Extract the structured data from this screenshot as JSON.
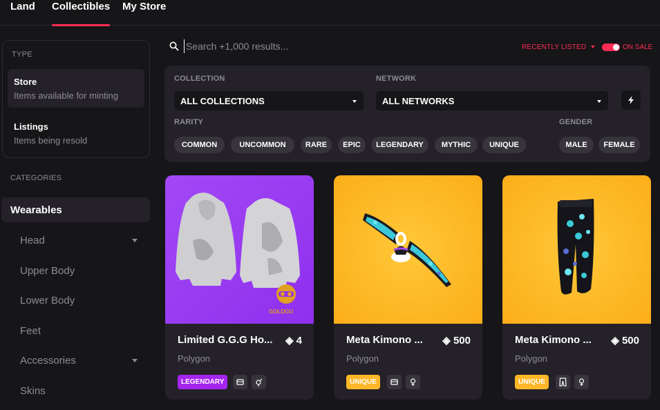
{
  "nav": {
    "tabs": [
      "Land",
      "Collectibles",
      "My Store"
    ]
  },
  "type_filter": {
    "title": "TYPE",
    "items": [
      {
        "name": "Store",
        "desc": "Items available for minting"
      },
      {
        "name": "Listings",
        "desc": "Items being resold"
      }
    ]
  },
  "categories": {
    "title": "CATEGORIES",
    "active": "Wearables",
    "items": [
      "Head",
      "Upper Body",
      "Lower Body",
      "Feet",
      "Accessories",
      "Skins"
    ]
  },
  "search": {
    "placeholder": "Search +1,000 results..."
  },
  "sort": {
    "label": "RECENTLY LISTED"
  },
  "on_sale": {
    "label": "ON SALE",
    "enabled": true
  },
  "filters": {
    "collection_label": "COLLECTION",
    "collection_value": "ALL COLLECTIONS",
    "network_label": "NETWORK",
    "network_value": "ALL NETWORKS",
    "rarity_label": "RARITY",
    "rarities": [
      "COMMON",
      "UNCOMMON",
      "RARE",
      "EPIC",
      "LEGENDARY",
      "MYTHIC",
      "UNIQUE"
    ],
    "gender_label": "GENDER",
    "genders": [
      "MALE",
      "FEMALE"
    ]
  },
  "cards": [
    {
      "title": "Limited G.G.G Ho...",
      "price": "4",
      "network": "Polygon",
      "rarity": "LEGENDARY",
      "rarity_color": "#a524f0",
      "bg": "#9a3bf1",
      "logo_text": "GOLDGU"
    },
    {
      "title": "Meta Kimono ...",
      "price": "500",
      "network": "Polygon",
      "rarity": "UNIQUE",
      "rarity_color": "#fdb727",
      "bg": "#fdb323"
    },
    {
      "title": "Meta Kimono ...",
      "price": "500",
      "network": "Polygon",
      "rarity": "UNIQUE",
      "rarity_color": "#fdb727",
      "bg": "#fdb323"
    }
  ],
  "colors": {
    "accent": "#ff2d55",
    "panel": "#242228",
    "background": "#161518"
  }
}
